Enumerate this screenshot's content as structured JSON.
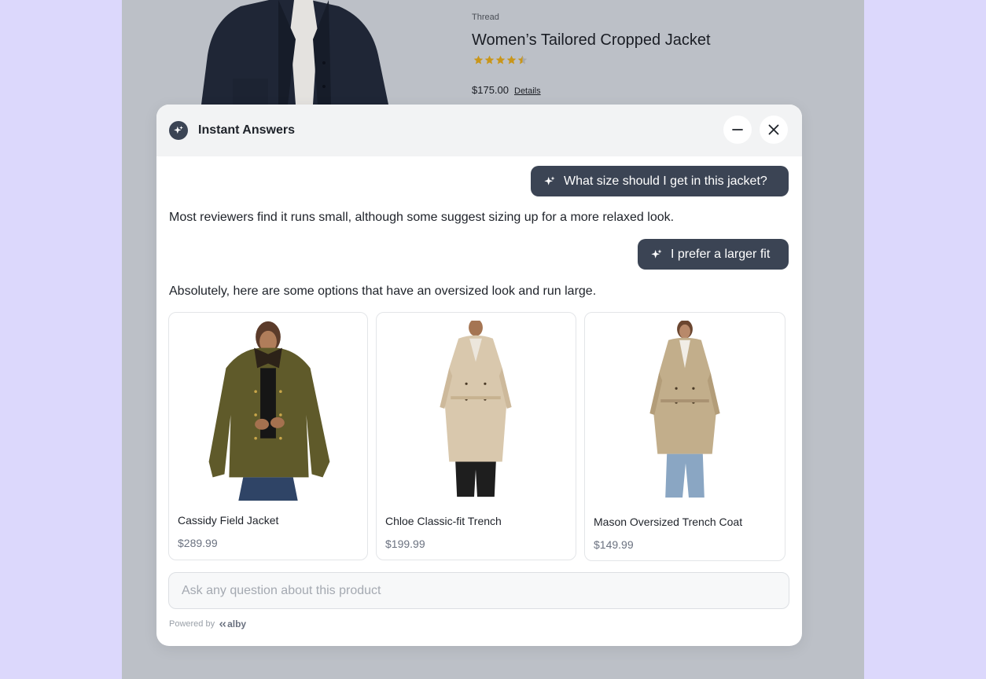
{
  "product": {
    "brand": "Thread",
    "title": "Women’s Tailored Cropped Jacket",
    "rating": 4.5,
    "rating_max": 5,
    "price": "$175.00",
    "details_link": "Details"
  },
  "widget": {
    "title": "Instant Answers",
    "icons": {
      "logo": "sparkle-icon",
      "minimize": "minus-icon",
      "close": "close-icon"
    },
    "messages": [
      {
        "role": "user",
        "text": "What size should I get in this jacket?"
      },
      {
        "role": "assistant",
        "text": "Most reviewers find it runs small, although some suggest sizing up for a more relaxed look."
      },
      {
        "role": "user",
        "text": "I prefer a larger fit"
      },
      {
        "role": "assistant",
        "text": "Absolutely, here are some options that have an oversized look and run large."
      }
    ],
    "products": [
      {
        "name": "Cassidy Field Jacket",
        "price": "$289.99"
      },
      {
        "name": "Chloe Classic-fit Trench",
        "price": "$199.99"
      },
      {
        "name": "Mason Oversized Trench Coat",
        "price": "$149.99"
      }
    ],
    "input": {
      "placeholder": "Ask any question about this product",
      "value": ""
    },
    "powered_by": "Powered by",
    "brand_name": "alby"
  },
  "colors": {
    "page_bg": "#dcd8fc",
    "backdrop": "#bcc0c7",
    "user_bubble": "#3b4454",
    "star": "#c9961a"
  }
}
